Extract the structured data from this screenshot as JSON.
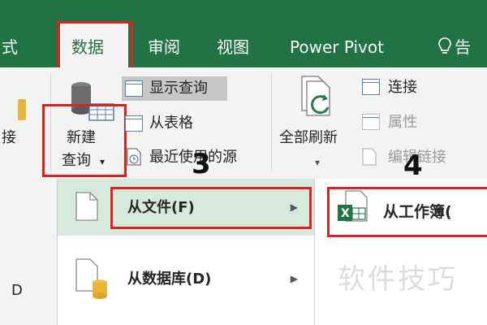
{
  "tabs": [
    {
      "label": "式",
      "active": false
    },
    {
      "label": "数据",
      "active": true
    },
    {
      "label": "审阅",
      "active": false
    },
    {
      "label": "视图",
      "active": false
    },
    {
      "label": "Power Pivot",
      "active": false
    },
    {
      "label": "告",
      "active": false
    }
  ],
  "ribbon": {
    "left_partial_label": "接",
    "new_query_line1": "新建",
    "new_query_line2": "查询",
    "new_query_caret": "▾",
    "show_queries": "显示查询",
    "from_table": "从表格",
    "recent_sources": "最近使用的源",
    "refresh_all": "全部刷新",
    "refresh_caret": "▾",
    "connections": "连接",
    "properties": "属性",
    "edit_links": "编辑链接"
  },
  "steps": {
    "step3": "3",
    "step4": "4"
  },
  "menu": {
    "items": [
      {
        "label": "从文件(F)",
        "active": true
      },
      {
        "label": "从数据库(D)",
        "active": false
      }
    ]
  },
  "submenu": {
    "items": [
      {
        "label": "从工作簿("
      }
    ],
    "excel_glyph": "X"
  },
  "watermark": "软件技巧",
  "left_strip_char": "D",
  "colors": {
    "excel_green": "#217346",
    "highlight_red": "#d9231f",
    "menu_hover": "#d7e9dc"
  }
}
